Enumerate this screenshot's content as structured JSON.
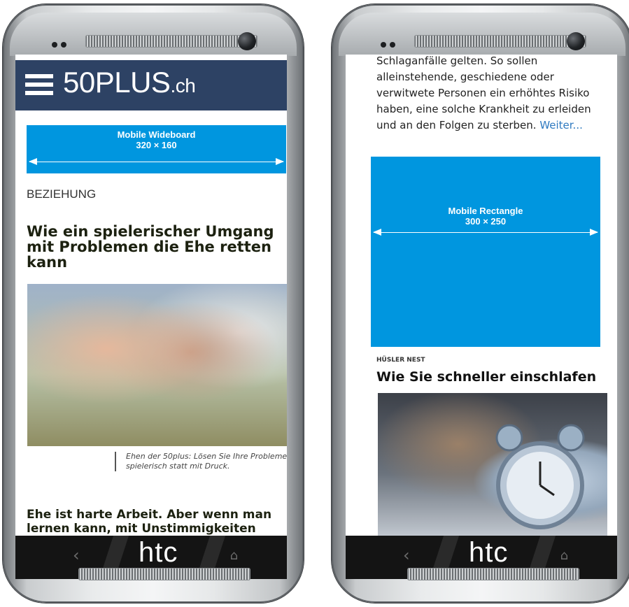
{
  "left_phone": {
    "brand": "htc",
    "logo_text": "50PLUS",
    "logo_suffix": ".ch",
    "ad": {
      "label": "Mobile Wideboard",
      "size": "320 × 160"
    },
    "category": "BEZIEHUNG",
    "headline": "Wie ein spielerischer Umgang mit Problemen die Ehe retten kann",
    "caption": "Ehen der 50plus: Lösen Sie Ihre Probleme spielerisch statt mit Druck.",
    "body": "Ehe ist harte Arbeit. Aber wenn man lernen kann, mit Unstimmigkeiten"
  },
  "right_phone": {
    "brand": "htc",
    "paragraph": "Schlaganfälle gelten. So sollen alleinstehende, geschiedene oder verwitwete Personen ein erhöhtes Risiko haben, eine solche Krankheit zu erleiden und an den Folgen zu sterben.",
    "link": "Weiter...",
    "ad": {
      "label": "Mobile Rectangle",
      "size": "300 × 250"
    },
    "category": "HÜSLER NEST",
    "headline": "Wie Sie schneller einschlafen"
  },
  "icons": {
    "back": "back-icon",
    "home": "home-icon",
    "menu": "menu-icon",
    "camera": "camera-icon"
  }
}
